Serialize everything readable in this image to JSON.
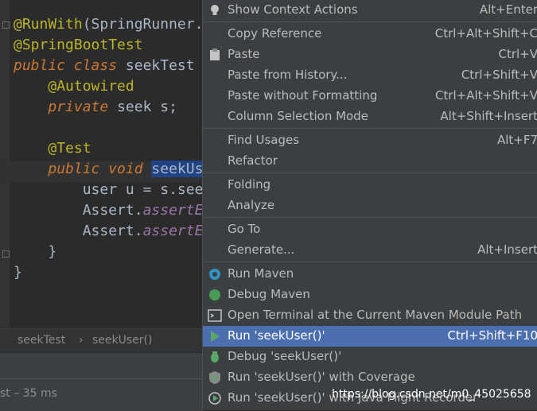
{
  "editor": {
    "lines": [
      {
        "parts": [
          [
            "ann",
            "@RunWith"
          ],
          [
            "plain",
            "(SpringRunner."
          ]
        ]
      },
      {
        "parts": [
          [
            "ann",
            "@SpringBootTest"
          ]
        ]
      },
      {
        "parts": [
          [
            "kw",
            "public class "
          ],
          [
            "plain",
            "seekTest"
          ]
        ]
      },
      {
        "parts": [
          [
            "plain",
            "    "
          ],
          [
            "ann",
            "@Autowired"
          ]
        ]
      },
      {
        "parts": [
          [
            "plain",
            "    "
          ],
          [
            "kw",
            "private "
          ],
          [
            "plain",
            "seek s;"
          ]
        ]
      },
      {
        "parts": [
          [
            "plain",
            ""
          ]
        ]
      },
      {
        "parts": [
          [
            "plain",
            "    "
          ],
          [
            "ann",
            "@Test"
          ]
        ]
      },
      {
        "parts": [
          [
            "plain",
            "    "
          ],
          [
            "kw",
            "public void "
          ],
          [
            "sel",
            "seekUs"
          ]
        ]
      },
      {
        "parts": [
          [
            "plain",
            "        user u = s.se"
          ],
          [
            "plain",
            "e"
          ]
        ]
      },
      {
        "parts": [
          [
            "plain",
            "        Assert."
          ],
          [
            "ital",
            "assertE"
          ]
        ]
      },
      {
        "parts": [
          [
            "plain",
            "        Assert."
          ],
          [
            "ital",
            "assertE"
          ]
        ]
      },
      {
        "parts": [
          [
            "plain",
            "    }"
          ]
        ]
      },
      {
        "parts": [
          [
            "plain",
            "}"
          ]
        ]
      }
    ]
  },
  "breadcrumb": {
    "class_name": "seekTest",
    "separator": "›",
    "method_name": "seekUser()"
  },
  "status": {
    "text": "st – 35 ms"
  },
  "menu": {
    "items": [
      {
        "label": "Show Context Actions",
        "mnemonic": "",
        "shortcut": "Alt+Enter",
        "icon": "bulb-icon",
        "name": "menu-show-context-actions"
      },
      {
        "sep": true
      },
      {
        "label": "Copy Reference",
        "shortcut": "Ctrl+Alt+Shift+C",
        "icon": "",
        "name": "menu-copy-reference"
      },
      {
        "label": "Paste",
        "shortcut": "Ctrl+V",
        "icon": "clipboard-icon",
        "name": "menu-paste"
      },
      {
        "label": "Paste from History...",
        "shortcut": "Ctrl+Shift+V",
        "icon": "",
        "name": "menu-paste-from-history"
      },
      {
        "label": "Paste without Formatting",
        "shortcut": "Ctrl+Alt+Shift+V",
        "icon": "",
        "name": "menu-paste-without-formatting"
      },
      {
        "label": "Column Selection Mode",
        "shortcut": "Alt+Shift+Insert",
        "icon": "",
        "name": "menu-column-selection-mode"
      },
      {
        "sep": true
      },
      {
        "label": "Find Usages",
        "shortcut": "Alt+F7",
        "icon": "",
        "name": "menu-find-usages"
      },
      {
        "label": "Refactor",
        "shortcut": "",
        "icon": "",
        "name": "menu-refactor"
      },
      {
        "sep": true
      },
      {
        "label": "Folding",
        "shortcut": "",
        "icon": "",
        "name": "menu-folding"
      },
      {
        "label": "Analyze",
        "shortcut": "",
        "icon": "",
        "name": "menu-analyze"
      },
      {
        "sep": true
      },
      {
        "label": "Go To",
        "shortcut": "",
        "icon": "",
        "name": "menu-go-to"
      },
      {
        "label": "Generate...",
        "shortcut": "Alt+Insert",
        "icon": "",
        "name": "menu-generate"
      },
      {
        "sep": true
      },
      {
        "label": "Run Maven",
        "shortcut": "",
        "icon": "maven-gear-icon",
        "name": "menu-run-maven"
      },
      {
        "label": "Debug Maven",
        "shortcut": "",
        "icon": "maven-debug-icon",
        "name": "menu-debug-maven"
      },
      {
        "label": "Open Terminal at the Current Maven Module Path",
        "shortcut": "",
        "icon": "terminal-icon",
        "name": "menu-open-terminal"
      },
      {
        "label": "Run 'seekUser()'",
        "shortcut": "Ctrl+Shift+F10",
        "icon": "run-icon",
        "name": "menu-run-seekuser",
        "active": true
      },
      {
        "label": "Debug 'seekUser()'",
        "shortcut": "",
        "icon": "debug-icon",
        "name": "menu-debug-seekuser"
      },
      {
        "label": "Run 'seekUser()' with Coverage",
        "shortcut": "",
        "icon": "coverage-icon",
        "name": "menu-run-coverage"
      },
      {
        "label": "Run 'seekUser()' with Java Flight Recorder",
        "shortcut": "",
        "icon": "flight-recorder-icon",
        "name": "menu-run-jfr"
      }
    ]
  },
  "watermark": {
    "text": "https://blog.csdn.net/m0_45025658"
  },
  "colors": {
    "menu_bg": "#3c3f41",
    "active_bg": "#4b6eaf",
    "editor_bg": "#2b2b2b",
    "annotation": "#bbb529",
    "keyword": "#cc7832"
  }
}
